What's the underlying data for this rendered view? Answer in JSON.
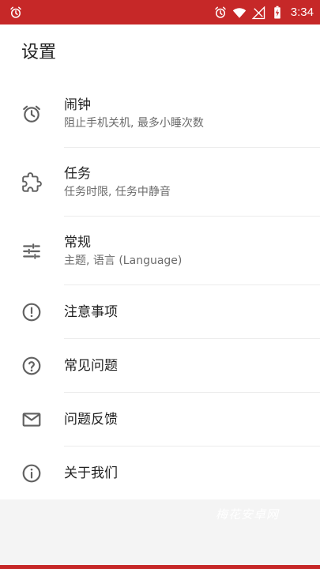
{
  "status_bar": {
    "time": "3:34",
    "icons": [
      "alarm-icon",
      "alarm-icon",
      "wifi-icon",
      "no-signal-icon",
      "battery-charging-icon"
    ]
  },
  "page": {
    "title": "设置"
  },
  "menu": {
    "items": [
      {
        "label": "闹钟",
        "sublabel": "阻止手机关机, 最多小睡次数",
        "icon": "alarm-clock-icon"
      },
      {
        "label": "任务",
        "sublabel": "任务时限, 任务中静音",
        "icon": "puzzle-icon"
      },
      {
        "label": "常规",
        "sublabel": "主题, 语言 (Language)",
        "icon": "sliders-icon"
      },
      {
        "label": "注意事项",
        "icon": "alert-circle-icon"
      },
      {
        "label": "常见问题",
        "icon": "help-circle-icon"
      },
      {
        "label": "问题反馈",
        "icon": "mail-icon"
      },
      {
        "label": "关于我们",
        "icon": "info-circle-icon"
      }
    ]
  },
  "watermark": "梅花安卓网",
  "colors": {
    "accent": "#c62828",
    "text_primary": "#212121",
    "text_secondary": "#6b6b6b",
    "icon": "#616161"
  }
}
